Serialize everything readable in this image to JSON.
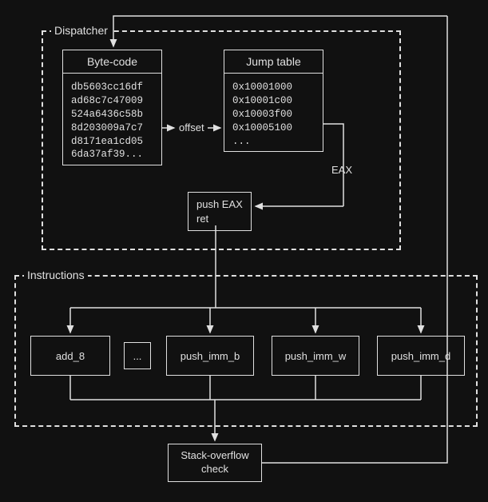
{
  "dispatcher": {
    "label": "Dispatcher",
    "bytecode": {
      "title": "Byte-code",
      "lines": "db5603cc16df\nad68c7c47009\n524a6436c58b\n8d203009a7c7\nd8171ea1cd05\n6da37af39..."
    },
    "jumptable": {
      "title": "Jump table",
      "lines": "0x10001000\n0x10001c00\n0x10003f00\n0x10005100\n..."
    },
    "offset_label": "offset",
    "eax_label": "EAX",
    "pushret": "push EAX\nret"
  },
  "instructions": {
    "label": "Instructions",
    "boxes": {
      "add8": "add_8",
      "ellipsis": "...",
      "push_imm_b": "push_imm_b",
      "push_imm_w": "push_imm_w",
      "push_imm_d": "push_imm_d"
    }
  },
  "stack_check": "Stack-overflow\ncheck"
}
